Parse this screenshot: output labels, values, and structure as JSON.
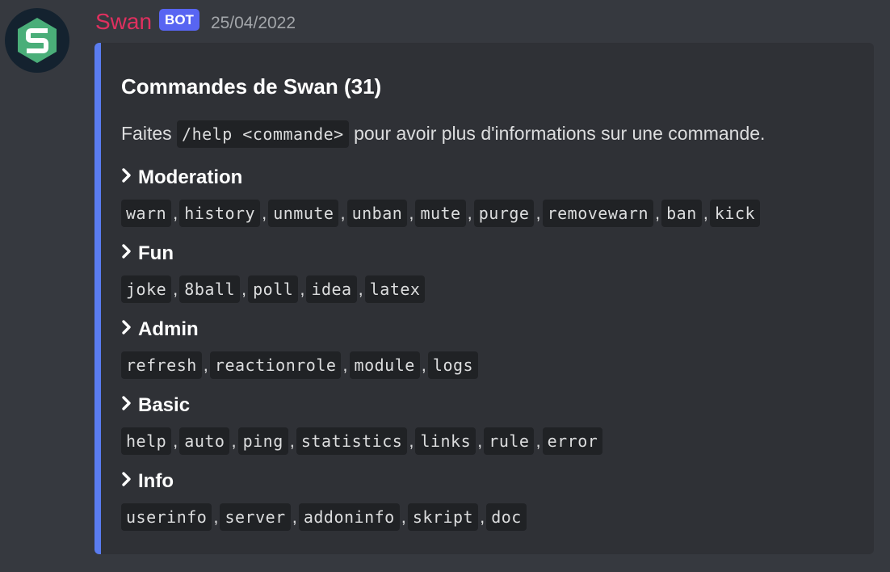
{
  "message": {
    "author": "Swan",
    "bot_badge": "BOT",
    "timestamp": "25/04/2022"
  },
  "embed": {
    "title": "Commandes de Swan (31)",
    "description_prefix": "Faites",
    "description_code": "/help <commande>",
    "description_suffix": "pour avoir plus d'informations sur une commande.",
    "accent_color": "#5a7cf0",
    "fields": [
      {
        "name": "Moderation",
        "commands": [
          "warn",
          "history",
          "unmute",
          "unban",
          "mute",
          "purge",
          "removewarn",
          "ban",
          "kick"
        ]
      },
      {
        "name": "Fun",
        "commands": [
          "joke",
          "8ball",
          "poll",
          "idea",
          "latex"
        ]
      },
      {
        "name": "Admin",
        "commands": [
          "refresh",
          "reactionrole",
          "module",
          "logs"
        ]
      },
      {
        "name": "Basic",
        "commands": [
          "help",
          "auto",
          "ping",
          "statistics",
          "links",
          "rule",
          "error"
        ]
      },
      {
        "name": "Info",
        "commands": [
          "userinfo",
          "server",
          "addoninfo",
          "skript",
          "doc"
        ]
      }
    ]
  },
  "icons": {
    "avatar": "swan-s-hexagon-icon",
    "field_bullet": "chevron-right-icon"
  },
  "colors": {
    "author": "#e0305f",
    "badge": "#5865f2",
    "background": "#36393f",
    "embed_background": "#2f3136"
  }
}
